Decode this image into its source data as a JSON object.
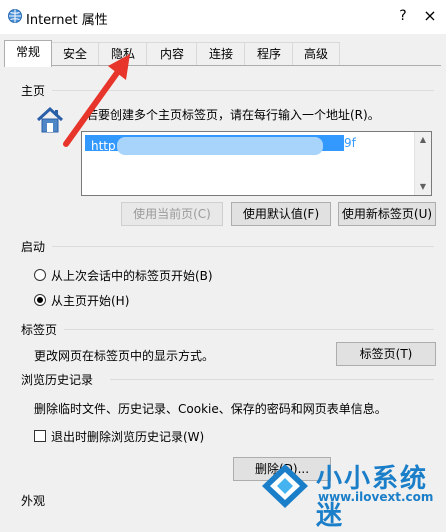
{
  "window": {
    "title": "Internet 属性",
    "help": "?",
    "close": "×"
  },
  "tabs": [
    "常规",
    "安全",
    "隐私",
    "内容",
    "连接",
    "程序",
    "高级"
  ],
  "active_tab": "常规",
  "homepage": {
    "section_title": "主页",
    "instruction": "若要创建多个主页标签页，请在每行输入一个地址(R)。",
    "url_prefix": "http",
    "url_suffix": "9f",
    "buttons": {
      "use_current": "使用当前页(C)",
      "use_default": "使用默认值(F)",
      "use_new_tab": "使用新标签页(U)"
    }
  },
  "startup": {
    "section_title": "启动",
    "option_last_session": "从上次会话中的标签页开始(B)",
    "option_homepage": "从主页开始(H)",
    "selected": "option_homepage"
  },
  "tabs_section": {
    "section_title": "标签页",
    "description": "更改网页在标签页中的显示方式。",
    "button": "标签页(T)"
  },
  "history": {
    "section_title": "浏览历史记录",
    "description": "删除临时文件、历史记录、Cookie、保存的密码和网页表单信息。",
    "checkbox_label": "退出时删除浏览历史记录(W)",
    "checkbox_checked": false,
    "delete_button": "删除(D)..."
  },
  "appearance": {
    "section_title": "外观"
  },
  "watermark": {
    "name": "小小系统迷",
    "url": "www.ilovext.com"
  },
  "colors": {
    "accent": "#1b7ec8",
    "selection": "#3399ff",
    "arrow": "#e8352b"
  }
}
